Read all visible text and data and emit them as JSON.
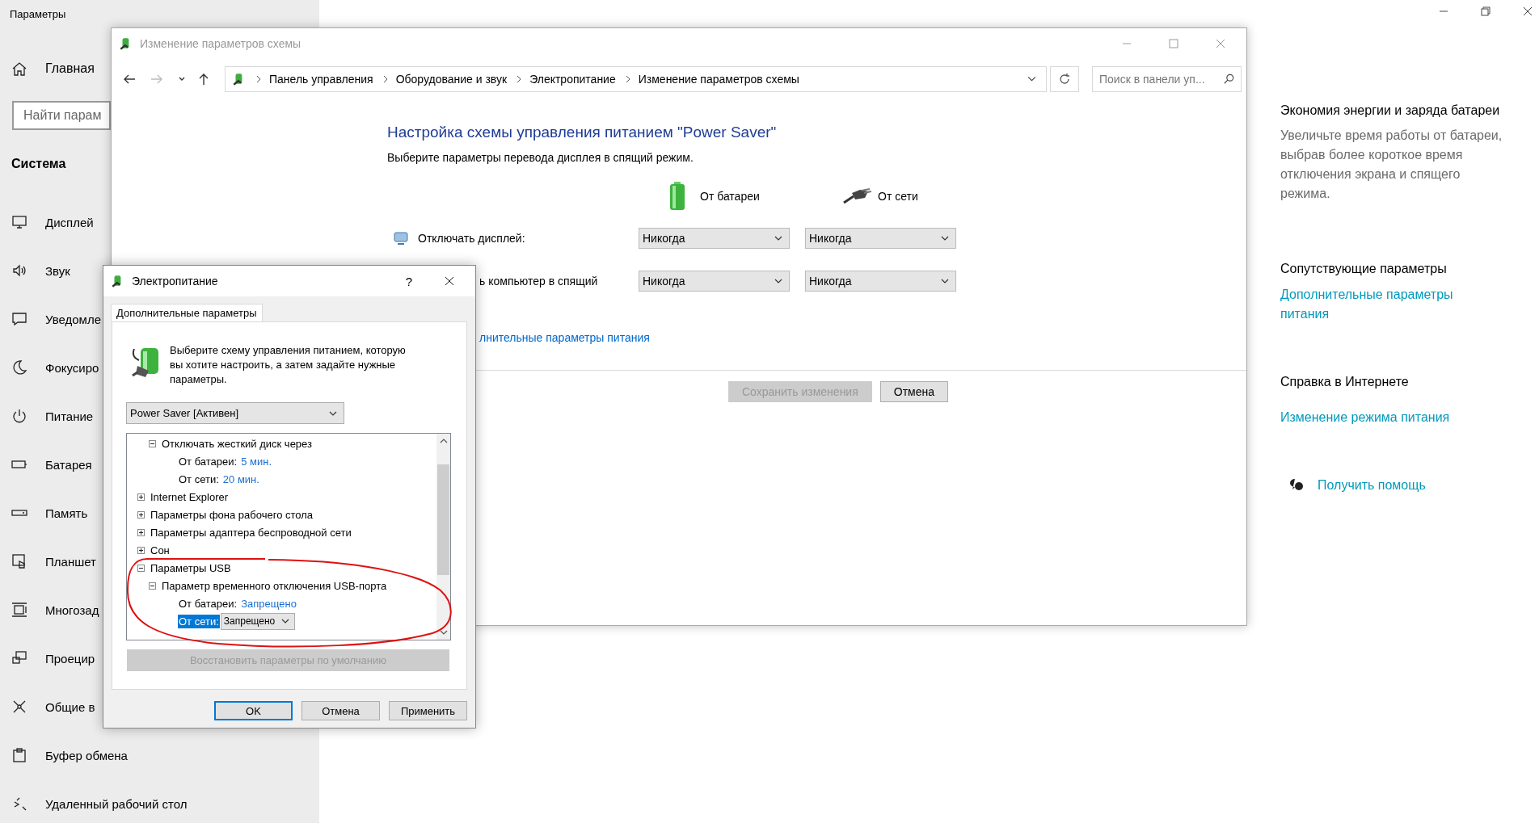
{
  "settings": {
    "title": "Параметры",
    "home": "Главная",
    "search": {
      "placeholder": "Найти парам"
    },
    "section": "Система",
    "nav_items": [
      {
        "label": "Дисплей"
      },
      {
        "label": "Звук"
      },
      {
        "label": "Уведомле"
      },
      {
        "label": "Фокусиро"
      },
      {
        "label": "Питание"
      },
      {
        "label": "Батарея"
      },
      {
        "label": "Память"
      },
      {
        "label": "Планшет"
      },
      {
        "label": "Многозад"
      },
      {
        "label": "Проецир"
      },
      {
        "label": "Общие в"
      },
      {
        "label": "Буфер обмена"
      },
      {
        "label": "Удаленный рабочий стол"
      }
    ]
  },
  "side_panel": {
    "heading": "Экономия энергии и заряда батареи",
    "description": "Увеличьте время работы от батареи, выбрав более короткое время отключения экрана и спящего режима.",
    "related_heading": "Сопутствующие параметры",
    "related_link": "Дополнительные параметры питания",
    "help_heading": "Справка в Интернете",
    "help_link": "Изменение режима питания",
    "get_help": "Получить помощь"
  },
  "control_panel": {
    "title": "Изменение параметров схемы",
    "active": false,
    "nav_buttons": [
      {
        "kind": "back",
        "disabled": false
      },
      {
        "kind": "forward",
        "disabled": true
      },
      {
        "kind": "recent",
        "disabled": false
      },
      {
        "kind": "up",
        "disabled": false
      }
    ],
    "breadcrumb": [
      "Панель управления",
      "Оборудование и звук",
      "Электропитание",
      "Изменение параметров схемы"
    ],
    "search": {
      "placeholder": "Поиск в панели уп..."
    },
    "heading": "Настройка схемы управления питанием \"Power Saver\"",
    "subheading": "Выберите параметры перевода дисплея в спящий режим.",
    "columns": [
      "От батареи",
      "От сети"
    ],
    "rows": [
      {
        "label": "Отключать дисплей:",
        "values": [
          "Никогда",
          "Никогда"
        ]
      },
      {
        "label": "ь компьютер в спящий",
        "values": [
          "Никогда",
          "Никогда"
        ]
      }
    ],
    "link": "лнительные параметры питания",
    "buttons": [
      {
        "label": "Сохранить изменения",
        "disabled": true
      },
      {
        "label": "Отмена",
        "disabled": false
      }
    ]
  },
  "dialog": {
    "title": "Электропитание",
    "active": true,
    "help": "?",
    "tabs": [
      {
        "label": "Дополнительные параметры",
        "selected": true
      }
    ],
    "intro": "Выберите схему управления питанием, которую вы хотите настроить, а затем задайте нужные параметры.",
    "scheme": "Power Saver [Активен]",
    "tree": [
      {
        "children": [
          {
            "kind": "group",
            "label": "Отключать жесткий диск через",
            "expanded": true,
            "selected": false,
            "children": [
              {
                "kind": "value",
                "label": "От батареи:",
                "value": "5 мин.",
                "selected": false
              },
              {
                "kind": "value",
                "label": "От сети:",
                "value": "20 мин.",
                "selected": false
              }
            ]
          }
        ]
      },
      {
        "kind": "group",
        "label": "Internet Explorer",
        "expanded": false,
        "selected": false
      },
      {
        "kind": "group",
        "label": "Параметры фона рабочего стола",
        "expanded": false,
        "selected": false
      },
      {
        "kind": "group",
        "label": "Параметры адаптера беспроводной сети",
        "expanded": false,
        "selected": false
      },
      {
        "kind": "group",
        "label": "Сон",
        "expanded": false,
        "selected": false
      },
      {
        "kind": "group",
        "label": "Параметры USB",
        "expanded": true,
        "selected": false,
        "children": [
          {
            "kind": "group",
            "label": "Параметр временного отключения USB-порта",
            "expanded": true,
            "selected": false,
            "children": [
              {
                "kind": "value",
                "label": "От батареи:",
                "value": "Запрещено",
                "selected": false
              },
              {
                "kind": "dropdown",
                "label": "От сети:",
                "value": "Запрещено",
                "selected": true
              }
            ]
          }
        ]
      }
    ],
    "restore": {
      "label": "Восстановить параметры по умолчанию",
      "disabled": true
    },
    "buttons": [
      {
        "label": "OK",
        "default": true
      },
      {
        "label": "Отмена",
        "default": false
      },
      {
        "label": "Применить",
        "default": false
      }
    ]
  }
}
